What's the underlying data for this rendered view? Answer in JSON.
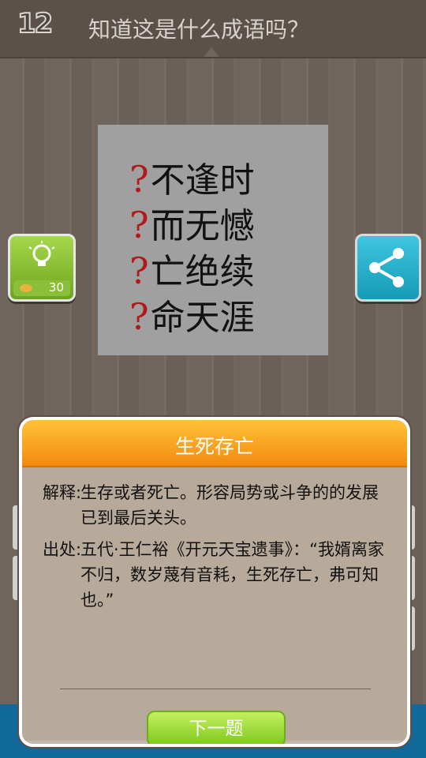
{
  "header": {
    "level": "12",
    "prompt": "知道这是什么成语吗？"
  },
  "puzzle": {
    "lines": [
      "不逢时",
      "而无憾",
      "亡绝续",
      "命天涯"
    ],
    "mark": "?"
  },
  "hint": {
    "cost": "30",
    "icon": "lightbulb-icon",
    "coin_icon": "coin-icon"
  },
  "share": {
    "icon": "share-icon"
  },
  "dialog": {
    "title": "生死存亡",
    "explain_label": "解释:",
    "explain_text": "生存或者死亡。形容局势或斗争的的发展已到最后关头。",
    "source_label": "出处:",
    "source_text": "五代·王仁裕《开元天宝遗事》：“我婿离家不归，数岁蔑有音耗，生死存亡，弗可知也。”",
    "next_label": "下一题"
  },
  "colors": {
    "header": "#f38a0e",
    "next": "#7dc71f",
    "hint": "#8bbf3a",
    "share": "#149bb6",
    "mark": "#b01a1a"
  }
}
